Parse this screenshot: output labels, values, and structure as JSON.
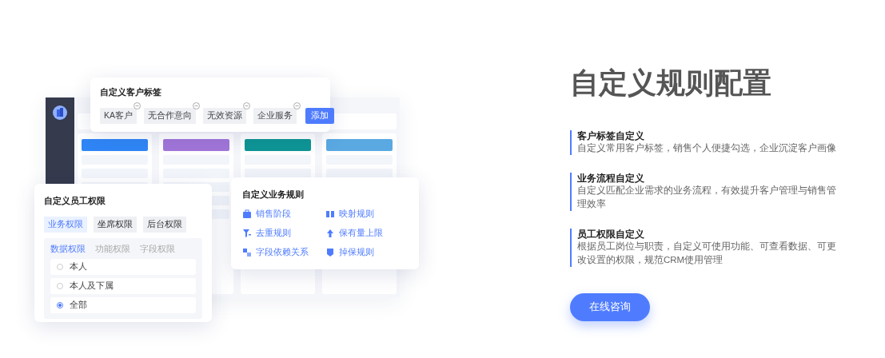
{
  "illustration": {
    "board_columns": [
      {
        "color": "#2f86f6"
      },
      {
        "color": "#a275d9"
      },
      {
        "color": "#0e9594"
      },
      {
        "color": "#5aa9e2"
      }
    ],
    "tag_card": {
      "title": "自定义客户标签",
      "tags": [
        "KA客户",
        "无合作意向",
        "无效资源",
        "企业服务"
      ],
      "add_button": "添加"
    },
    "permission_card": {
      "title": "自定义员工权限",
      "tabs": [
        {
          "label": "业务权限",
          "selected": true
        },
        {
          "label": "坐席权限",
          "selected": false
        },
        {
          "label": "后台权限",
          "selected": false
        }
      ],
      "subtabs": [
        {
          "label": "数据权限",
          "selected": true
        },
        {
          "label": "功能权限",
          "selected": false
        },
        {
          "label": "字段权限",
          "selected": false
        }
      ],
      "options": [
        {
          "label": "本人",
          "selected": false
        },
        {
          "label": "本人及下属",
          "selected": false
        },
        {
          "label": "全部",
          "selected": true
        }
      ]
    },
    "rules_card": {
      "title": "自定义业务规则",
      "items": [
        "销售阶段",
        "映射规则",
        "去重规则",
        "保有量上限",
        "字段依赖关系",
        "掉保规则"
      ]
    }
  },
  "headline": "自定义规则配置",
  "features": [
    {
      "title": "客户标签自定义",
      "description": "自定义常用客户标签，销售个人便捷勾选，企业沉淀客户画像"
    },
    {
      "title": "业务流程自定义",
      "description": "自定义匹配企业需求的业务流程，有效提升客户管理与销售管理效率"
    },
    {
      "title": "员工权限自定义",
      "description": "根据员工岗位与职责，自定义可使用功能、可查看数据、可更改设置的权限，规范CRM使用管理"
    }
  ],
  "cta_button": "在线咨询"
}
